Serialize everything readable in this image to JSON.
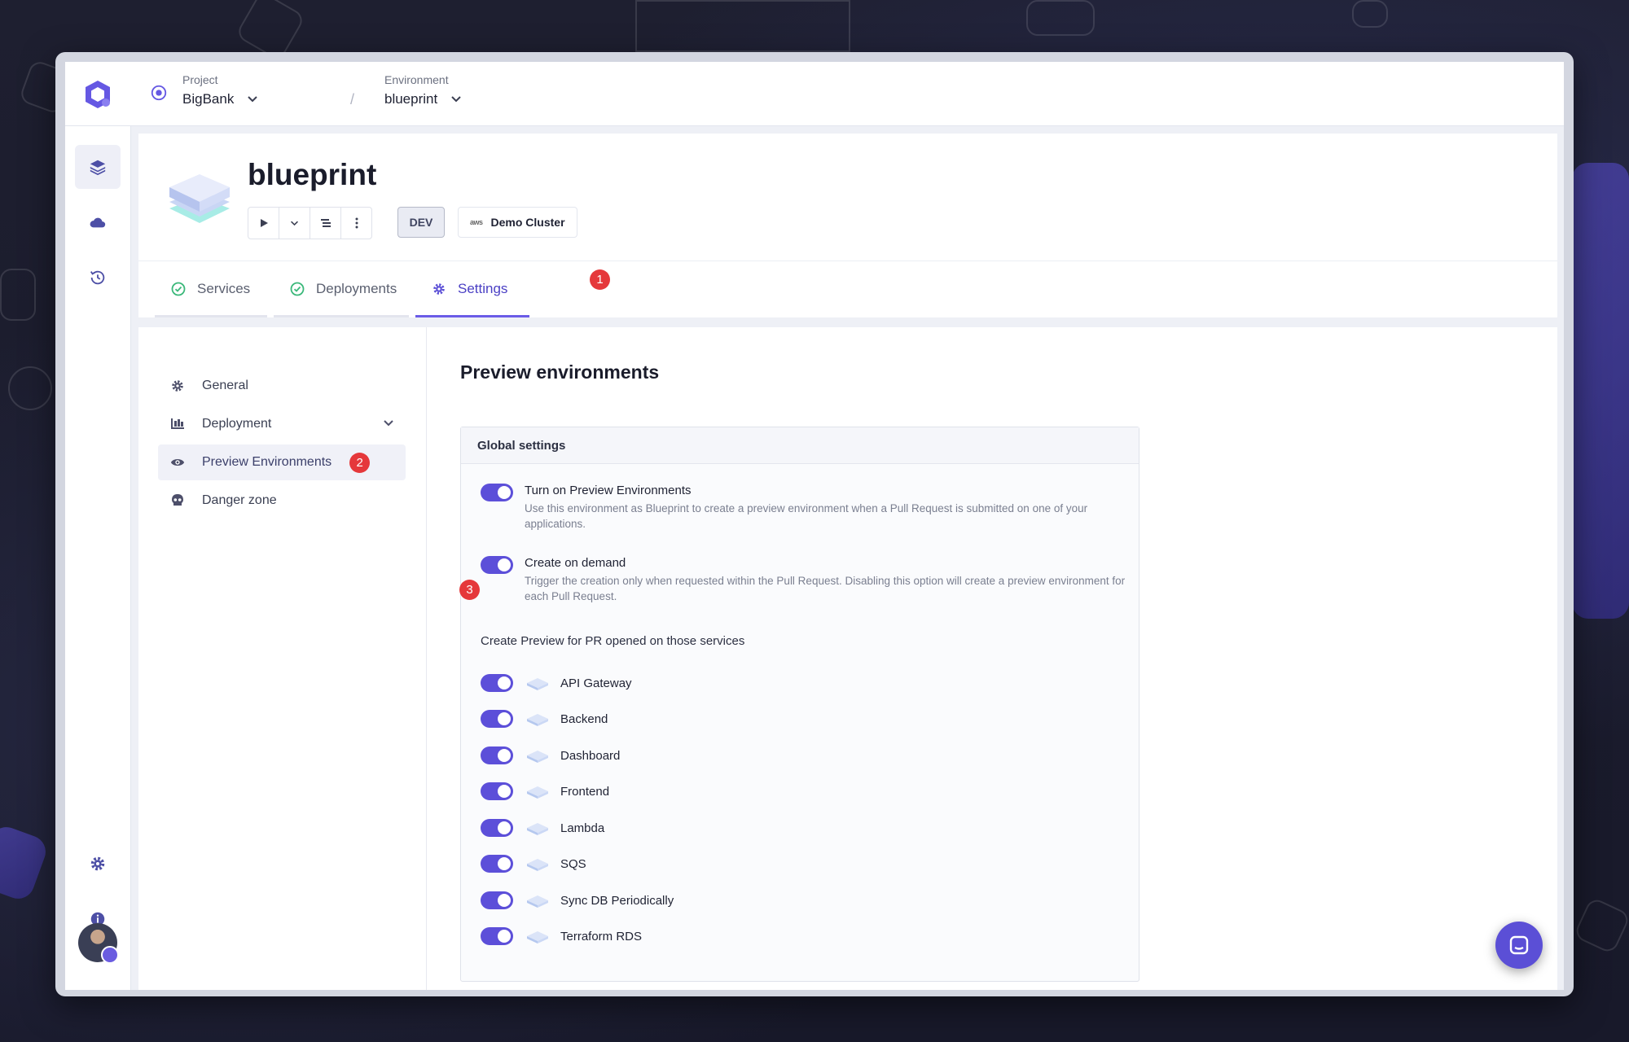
{
  "breadcrumb": {
    "project_label": "Project",
    "project_value": "BigBank",
    "separator": "/",
    "environment_label": "Environment",
    "environment_value": "blueprint"
  },
  "rail": {
    "icons": [
      "layers-icon",
      "cloud-icon",
      "history-icon",
      "settings-icon",
      "info-icon"
    ]
  },
  "header": {
    "title": "blueprint",
    "env_badge": "DEV",
    "cluster_provider": "aws",
    "cluster_name": "Demo Cluster"
  },
  "tabs": [
    {
      "label": "Services",
      "status": "ok"
    },
    {
      "label": "Deployments",
      "status": "ok"
    },
    {
      "label": "Settings",
      "active": true,
      "badge": "1"
    }
  ],
  "settings_nav": [
    {
      "label": "General"
    },
    {
      "label": "Deployment",
      "expandable": true
    },
    {
      "label": "Preview Environments",
      "active": true,
      "badge": "2"
    },
    {
      "label": "Danger zone"
    }
  ],
  "main": {
    "title": "Preview environments",
    "global_settings_title": "Global settings",
    "options": [
      {
        "title": "Turn on Preview Environments",
        "description": "Use this environment as Blueprint to create a preview environment when a Pull Request is submitted on one of your applications.",
        "enabled": true
      },
      {
        "title": "Create on demand",
        "description": "Trigger the creation only when requested within the Pull Request. Disabling this option will create a preview environment for each Pull Request.",
        "enabled": true,
        "badge": "3"
      }
    ],
    "services_label": "Create Preview for PR opened on those services",
    "services": [
      {
        "name": "API Gateway",
        "enabled": true
      },
      {
        "name": "Backend",
        "enabled": true
      },
      {
        "name": "Dashboard",
        "enabled": true
      },
      {
        "name": "Frontend",
        "enabled": true
      },
      {
        "name": "Lambda",
        "enabled": true
      },
      {
        "name": "SQS",
        "enabled": true
      },
      {
        "name": "Sync DB Periodically",
        "enabled": true
      },
      {
        "name": "Terraform RDS",
        "enabled": true
      }
    ]
  },
  "colors": {
    "accent": "#5c4fd9",
    "badge_red": "#e5383b",
    "success": "#3bb87a"
  }
}
